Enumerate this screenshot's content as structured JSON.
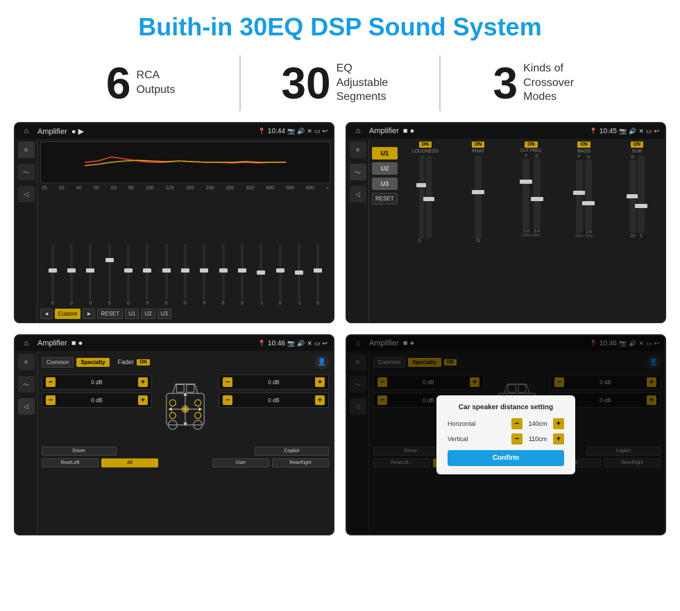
{
  "page": {
    "title": "Buith-in 30EQ DSP Sound System"
  },
  "stats": [
    {
      "number": "6",
      "label_line1": "RCA",
      "label_line2": "Outputs"
    },
    {
      "number": "30",
      "label_line1": "EQ Adjustable",
      "label_line2": "Segments"
    },
    {
      "number": "3",
      "label_line1": "Kinds of",
      "label_line2": "Crossover Modes"
    }
  ],
  "screens": [
    {
      "title": "Amplifier",
      "time": "10:44",
      "type": "eq",
      "eq_freqs": [
        "25",
        "32",
        "40",
        "50",
        "63",
        "80",
        "100",
        "125",
        "160",
        "200",
        "250",
        "320",
        "400",
        "500",
        "630"
      ],
      "eq_vals": [
        "0",
        "0",
        "0",
        "5",
        "0",
        "0",
        "0",
        "0",
        "0",
        "0",
        "0",
        "-1",
        "0",
        "-1"
      ],
      "eq_preset": "Custom",
      "eq_presets": [
        "RESET",
        "U1",
        "U2",
        "U3"
      ]
    },
    {
      "title": "Amplifier",
      "time": "10:45",
      "type": "crossover",
      "u_options": [
        "U1",
        "U2",
        "U3"
      ],
      "channels": [
        "LOUDNESS",
        "PHAT",
        "CUT FREQ",
        "BASS",
        "SUB"
      ]
    },
    {
      "title": "Amplifier",
      "time": "10:46",
      "type": "fader",
      "tabs": [
        "Common",
        "Specialty"
      ],
      "active_tab": "Specialty",
      "fader_label": "Fader",
      "fader_on": true,
      "controls": [
        {
          "label": "0 dB"
        },
        {
          "label": "0 dB"
        },
        {
          "label": "0 dB"
        },
        {
          "label": "0 dB"
        }
      ],
      "footer_btns": [
        "Driver",
        "",
        "",
        "",
        "Copilot"
      ],
      "footer_btns2": [
        "RearLeft",
        "All",
        "",
        "User",
        "RearRight"
      ]
    },
    {
      "title": "Amplifier",
      "time": "10:46",
      "type": "fader-dialog",
      "tabs": [
        "Common",
        "Specialty"
      ],
      "active_tab": "Specialty",
      "dialog": {
        "title": "Car speaker distance setting",
        "horizontal_label": "Horizontal",
        "horizontal_val": "140cm",
        "vertical_label": "Vertical",
        "vertical_val": "110cm",
        "confirm_label": "Confirm"
      },
      "controls": [
        {
          "label": "0 dB"
        },
        {
          "label": "0 dB"
        }
      ],
      "footer_btns": [
        "Driver",
        "",
        "",
        "",
        "Copilot"
      ],
      "footer_btns2": [
        "RearLef...",
        "",
        "",
        "User",
        "RearRight"
      ]
    }
  ]
}
